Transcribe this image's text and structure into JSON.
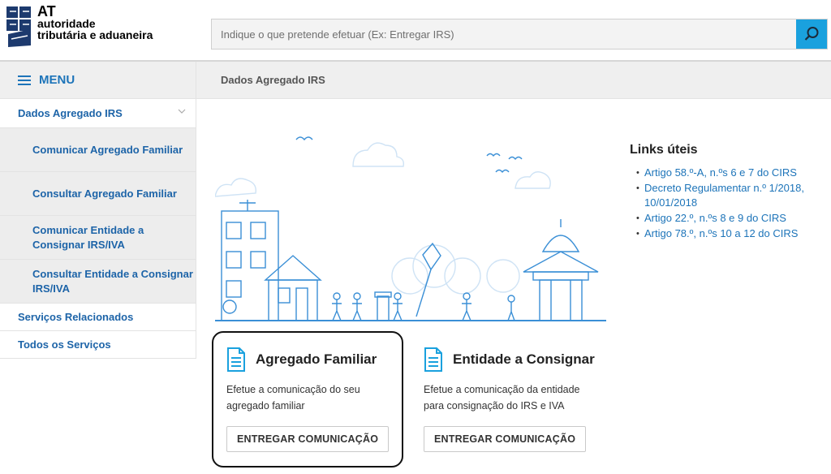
{
  "header": {
    "logo": {
      "at": "AT",
      "line1": "autoridade",
      "line2": "tributária e aduaneira"
    },
    "search": {
      "placeholder": "Indique o que pretende efetuar (Ex: Entregar IRS)",
      "icon": "search-icon"
    }
  },
  "sidebar": {
    "menu_label": "MENU",
    "active_section": "Dados Agregado IRS",
    "sub_items": [
      {
        "label": "Comunicar Agregado Familiar"
      },
      {
        "label": "Consultar Agregado Familiar"
      },
      {
        "label": "Comunicar Entidade a Consignar IRS/IVA"
      },
      {
        "label": "Consultar Entidade a Consignar IRS/IVA"
      }
    ],
    "other_items": [
      {
        "label": "Serviços Relacionados"
      },
      {
        "label": "Todos os Serviços"
      }
    ]
  },
  "breadcrumb": "Dados Agregado IRS",
  "links": {
    "title": "Links úteis",
    "items": [
      "Artigo 58.º-A, n.ºs 6 e 7 do CIRS",
      "Decreto Regulamentar n.º 1/2018, 10/01/2018",
      "Artigo 22.º, n.ºs 8 e 9 do CIRS",
      "Artigo 78.º, n.ºs 10 a 12 do CIRS"
    ]
  },
  "cards": [
    {
      "title": "Agregado Familiar",
      "description": "Efetue a comunicação do seu agregado familiar",
      "button": "ENTREGAR COMUNICAÇÃO",
      "icon": "document-icon"
    },
    {
      "title": "Entidade a Consignar",
      "description": "Efetue a comunicação da entidade para consignação do IRS e IVA",
      "button": "ENTREGAR COMUNICAÇÃO",
      "icon": "document-icon"
    }
  ],
  "colors": {
    "accent": "#1aa1de",
    "link": "#1d74b9",
    "sidebar_text": "#1d64a8"
  }
}
